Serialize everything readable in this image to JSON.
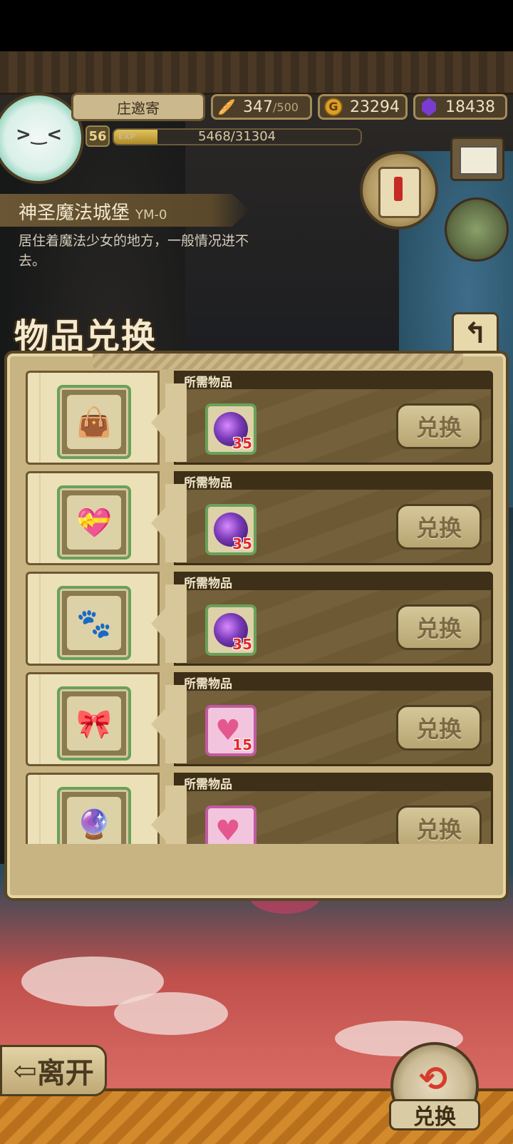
{
  "player": {
    "name": "庄邀寄",
    "level": "56",
    "exp_label": "EXP",
    "exp_text": "5468/31304",
    "exp_progress": 0.175
  },
  "resources": {
    "stamina": {
      "icon": "bread-icon",
      "value": "347",
      "max": "/500"
    },
    "gold": {
      "icon": "gold-coin-icon",
      "value": "23294"
    },
    "gems": {
      "icon": "purple-gem-icon",
      "value": "18438"
    }
  },
  "location": {
    "title": "神圣魔法城堡",
    "code": "YM-0",
    "description": "居住着魔法少女的地方，一般情况进不去。"
  },
  "panel": {
    "title": "物品兑换",
    "back_icon": "return-arrow-icon"
  },
  "exchange_items": [
    {
      "reward_icon": "shoulder-bag-icon",
      "required_label": "所需物品",
      "required_icon": "purple-orb-icon",
      "required_qty": "35",
      "button": "兑换"
    },
    {
      "reward_icon": "heart-bow-wings-icon",
      "required_label": "所需物品",
      "required_icon": "purple-orb-icon",
      "required_qty": "35",
      "button": "兑换"
    },
    {
      "reward_icon": "cat-paw-icon",
      "required_label": "所需物品",
      "required_icon": "purple-orb-icon",
      "required_qty": "35",
      "button": "兑换"
    },
    {
      "reward_icon": "heart-bow-tie-icon",
      "required_label": "所需物品",
      "required_icon": "pink-heart-crown-icon",
      "required_qty": "15",
      "button": "兑换"
    },
    {
      "reward_icon": "purple-orb-icon",
      "required_label": "所需物品",
      "required_icon": "pink-heart-crown-icon",
      "required_qty": "",
      "button": "兑换"
    }
  ],
  "bottom": {
    "leave": "离开",
    "exchange": "兑换"
  },
  "colors": {
    "panel_bg": "#c8b482",
    "panel_border": "#5a4624",
    "qty_red": "#e02a2a",
    "green_frame": "#6aa05a",
    "pink_frame": "#c05aa0"
  }
}
